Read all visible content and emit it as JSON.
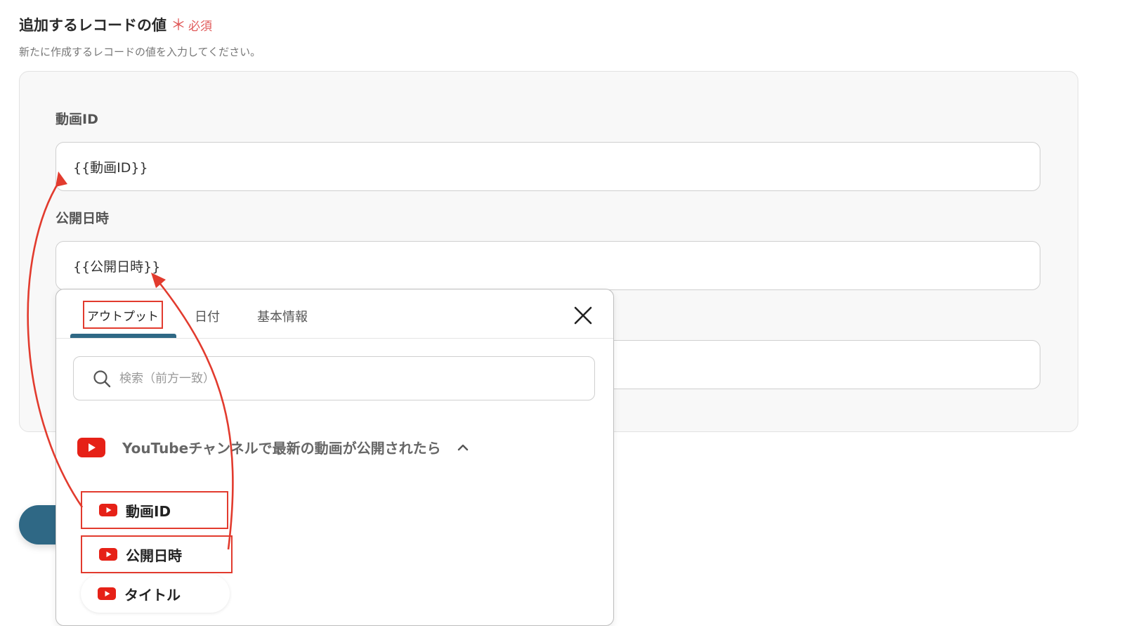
{
  "section": {
    "title": "追加するレコードの値",
    "required_mark": "＊",
    "required_label": "必須",
    "description": "新たに作成するレコードの値を入力してください。"
  },
  "fields": [
    {
      "label": "動画ID",
      "value": "{{動画ID}}"
    },
    {
      "label": "公開日時",
      "value": "{{公開日時}}"
    },
    {
      "label": "",
      "value": ""
    }
  ],
  "popup": {
    "tabs": [
      {
        "label": "アウトプット",
        "active": true
      },
      {
        "label": "日付"
      },
      {
        "label": "基本情報"
      }
    ],
    "search": {
      "placeholder": "検索（前方一致）",
      "value": ""
    },
    "group": {
      "title": "YouTubeチャンネルで最新の動画が公開されたら",
      "icon": "youtube-icon",
      "expanded": true
    },
    "items": [
      {
        "label": "動画ID",
        "icon": "youtube-icon",
        "highlighted": true
      },
      {
        "label": "公開日時",
        "icon": "youtube-icon",
        "highlighted": true
      },
      {
        "label": "タイトル",
        "icon": "youtube-icon",
        "highlighted": false
      }
    ]
  },
  "colors": {
    "accent": "#2f6885",
    "required": "#e05a5a",
    "highlight": "#e23b2e",
    "youtube": "#e62117"
  }
}
